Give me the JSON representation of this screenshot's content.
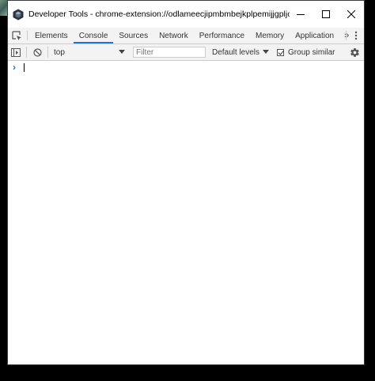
{
  "window": {
    "title": "Developer Tools - chrome-extension://odlameecjipmbmbejkplpemijjgpljce/index.ht..."
  },
  "tabs": [
    {
      "label": "Elements",
      "active": false
    },
    {
      "label": "Console",
      "active": true
    },
    {
      "label": "Sources",
      "active": false
    },
    {
      "label": "Network",
      "active": false
    },
    {
      "label": "Performance",
      "active": false
    },
    {
      "label": "Memory",
      "active": false
    },
    {
      "label": "Application",
      "active": false
    }
  ],
  "tabs_more": "»",
  "console_toolbar": {
    "context": "top",
    "filter_placeholder": "Filter",
    "levels": "Default levels",
    "group_similar": "Group similar",
    "group_similar_checked": true
  },
  "console": {
    "prompt_symbol": "›"
  },
  "colors": {
    "accent": "#1a73e8",
    "toolbar_bg": "#f3f3f3",
    "border": "#cccccc"
  }
}
